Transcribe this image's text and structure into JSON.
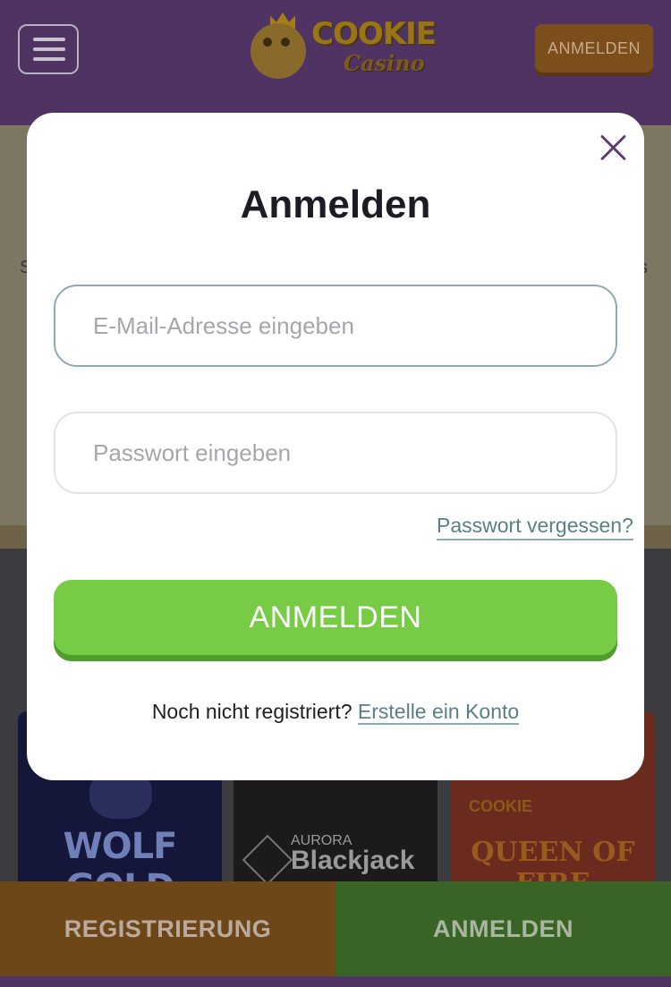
{
  "header": {
    "menu_icon": "hamburger-menu-icon",
    "logo": {
      "line1": "COOKIE",
      "line2": "Casino"
    },
    "login_button": "ANMELDEN"
  },
  "background": {
    "banner_left_fragment": "S",
    "banner_right_fragment": "s",
    "games": [
      {
        "title": "WOLF GOLD"
      },
      {
        "subtitle": "AURORA",
        "title": "Blackjack"
      },
      {
        "title": "QUEEN OF FIRE"
      }
    ]
  },
  "modal": {
    "title": "Anmelden",
    "close_icon": "close-icon",
    "email": {
      "placeholder": "E-Mail-Adresse eingeben",
      "value": ""
    },
    "password": {
      "placeholder": "Passwort eingeben",
      "value": ""
    },
    "forgot_password": "Passwort vergessen?",
    "submit": "ANMELDEN",
    "register_prompt": "Noch nicht registriert?",
    "register_link": "Erstelle ein Konto"
  },
  "bottom_bar": {
    "register": "REGISTRIERUNG",
    "login": "ANMELDEN"
  },
  "colors": {
    "header_purple": "#4f3463",
    "primary_green": "#77cb45",
    "accent_orange": "#7c4e1c",
    "link_teal": "#5a7f86"
  }
}
